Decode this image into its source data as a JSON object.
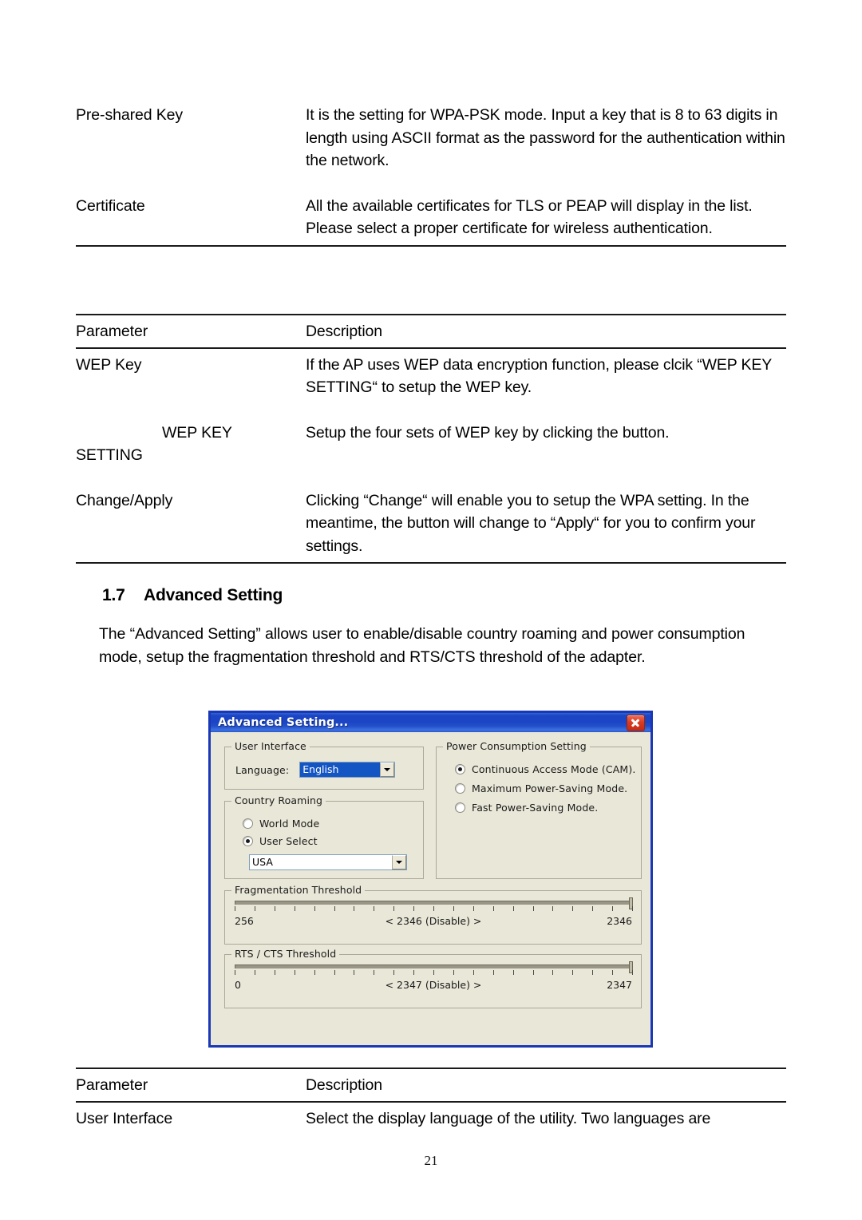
{
  "document": {
    "page_number": "21",
    "table_top": {
      "rows": [
        {
          "parameter": "Pre-shared Key",
          "description": "It is the setting for WPA-PSK mode. Input a key that is 8 to 63 digits in length using ASCII format as the password for the authentication within the network."
        },
        {
          "parameter": "Certificate",
          "description": "All the available certificates for TLS or PEAP will display in the list. Please select a proper certificate for wireless authentication."
        }
      ]
    },
    "table_middle": {
      "header": {
        "parameter": "Parameter",
        "description": "Description"
      },
      "rows": [
        {
          "parameter": "WEP Key",
          "description": "If the AP uses WEP data encryption function, please clcik “WEP KEY SETTING“ to setup the WEP key."
        },
        {
          "parameter": "WEP KEY",
          "parameter_line2": "SETTING",
          "description": "Setup the four sets of WEP key by clicking the button."
        },
        {
          "parameter": "Change/Apply",
          "description": "Clicking “Change“ will enable you to setup the WPA setting. In the meantime, the button will change to “Apply“ for you to confirm your settings."
        }
      ]
    },
    "section": {
      "number": "1.7",
      "title": "Advanced Setting",
      "paragraph": "The “Advanced Setting” allows user to enable/disable country roaming and power consumption mode, setup the fragmentation threshold and RTS/CTS threshold of the adapter."
    },
    "table_bottom": {
      "header": {
        "parameter": "Parameter",
        "description": "Description"
      },
      "rows": [
        {
          "parameter": "User Interface",
          "description": "Select the display language of the utility. Two languages are"
        }
      ]
    }
  },
  "dialog": {
    "title": "Advanced Setting...",
    "close_icon": "close-icon",
    "colors": {
      "titlebar_blue": "#1b45c4",
      "border_blue": "#1a37b5",
      "face": "#e9e7d8",
      "selection_blue": "#1455c4",
      "close_red": "#d93d23"
    },
    "user_interface": {
      "legend": "User Interface",
      "language_label": "Language:",
      "language_value": "English"
    },
    "country_roaming": {
      "legend": "Country Roaming",
      "options": [
        {
          "label": "World Mode",
          "checked": false
        },
        {
          "label": "User Select",
          "checked": true
        }
      ],
      "country_value": "USA"
    },
    "power_consumption": {
      "legend": "Power Consumption Setting",
      "options": [
        {
          "label": "Continuous Access Mode (CAM).",
          "checked": true
        },
        {
          "label": "Maximum Power-Saving Mode.",
          "checked": false
        },
        {
          "label": "Fast Power-Saving Mode.",
          "checked": false
        }
      ]
    },
    "fragmentation_threshold": {
      "legend": "Fragmentation Threshold",
      "min_label": "256",
      "max_label": "2346",
      "current_label": "< 2346 (Disable) >",
      "min": 256,
      "max": 2346,
      "value": 2346,
      "tick_count": 21
    },
    "rts_cts_threshold": {
      "legend": "RTS / CTS Threshold",
      "min_label": "0",
      "max_label": "2347",
      "current_label": "< 2347 (Disable) >",
      "min": 0,
      "max": 2347,
      "value": 2347,
      "tick_count": 21
    }
  }
}
